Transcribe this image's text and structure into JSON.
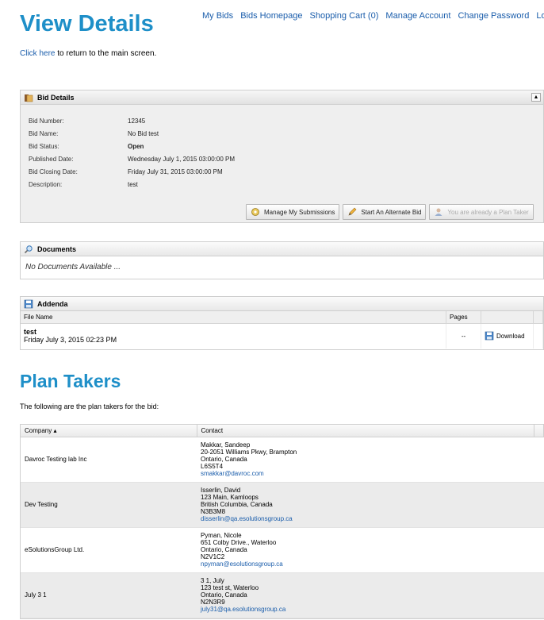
{
  "nav": {
    "links": [
      "My Bids",
      "Bids Homepage",
      "Shopping Cart (0)",
      "Manage Account",
      "Change Password",
      "Logout"
    ]
  },
  "page": {
    "title": "View Details",
    "return_link": "Click here",
    "return_text": " to return to the main screen."
  },
  "bid_details": {
    "header": "Bid Details",
    "fields": [
      {
        "label": "Bid Number:",
        "value": "12345"
      },
      {
        "label": "Bid Name:",
        "value": "No Bid test"
      },
      {
        "label": "Bid Status:",
        "value": "Open"
      },
      {
        "label": "Published Date:",
        "value": "Wednesday July 1, 2015 03:00:00 PM"
      },
      {
        "label": "Bid Closing Date:",
        "value": "Friday July 31, 2015 03:00:00 PM"
      },
      {
        "label": "Description:",
        "value": "test"
      }
    ],
    "buttons": {
      "manage": "Manage My Submissions",
      "alternate": "Start An Alternate Bid",
      "plan_taker": "You are already a Plan Taker"
    }
  },
  "documents": {
    "header": "Documents",
    "empty_text": "No Documents Available ..."
  },
  "addenda": {
    "header": "Addenda",
    "columns": {
      "file": "File Name",
      "pages": "Pages"
    },
    "rows": [
      {
        "name": "test",
        "date": "Friday July 3, 2015 02:23 PM",
        "pages": "--",
        "action": "Download"
      }
    ]
  },
  "plan_takers": {
    "title": "Plan Takers",
    "subtitle": "The following are the plan takers for the bid:",
    "columns": {
      "company": "Company ▴",
      "contact": "Contact"
    },
    "rows": [
      {
        "company": "Davroc Testing lab Inc",
        "name": "Makkar, Sandeep",
        "address": "20-2051 Williams Pkwy, Brampton",
        "region": "Ontario, Canada",
        "postal": "L6S5T4",
        "email": "smakkar@davroc.com"
      },
      {
        "company": "Dev Testing",
        "name": "Isserlin, David",
        "address": "123 Main, Kamloops",
        "region": "British Columbia, Canada",
        "postal": "N3B3M8",
        "email": "disserlin@qa.esolutionsgroup.ca"
      },
      {
        "company": "eSolutionsGroup Ltd.",
        "name": "Pyman, Nicole",
        "address": "651 Colby Drive., Waterloo",
        "region": "Ontario, Canada",
        "postal": "N2V1C2",
        "email": "npyman@esolutionsgroup.ca"
      },
      {
        "company": "July 3 1",
        "name": "3 1, July",
        "address": "123 test st, Waterloo",
        "region": "Ontario, Canada",
        "postal": "N2N3R9",
        "email": "july31@qa.esolutionsgroup.ca"
      }
    ]
  }
}
